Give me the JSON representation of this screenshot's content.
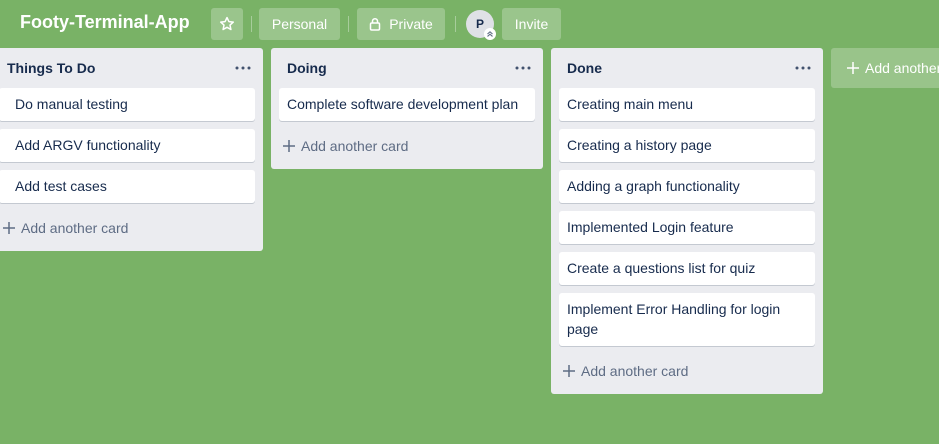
{
  "board": {
    "title": "Footy-Terminal-App",
    "star_icon": "star-icon",
    "visibility_team": "Personal",
    "visibility_privacy": "Private",
    "privacy_icon": "lock-icon",
    "member_initial": "P",
    "invite_label": "Invite",
    "background_color": "#79b266"
  },
  "lists": [
    {
      "title": "Things To Do",
      "menu_icon": "more-horizontal-icon",
      "cards": [
        "Do manual testing",
        "Add ARGV functionality",
        "Add test cases"
      ],
      "add_card_label": "Add another card"
    },
    {
      "title": "Doing",
      "menu_icon": "more-horizontal-icon",
      "cards": [
        "Complete software development plan"
      ],
      "add_card_label": "Add another card"
    },
    {
      "title": "Done",
      "menu_icon": "more-horizontal-icon",
      "cards": [
        "Creating main menu",
        "Creating a history page",
        "Adding a graph functionality",
        "Implemented Login feature",
        "Create a questions list for quiz",
        "Implement Error Handling for login page"
      ],
      "add_card_label": "Add another card"
    }
  ],
  "add_list_label": "Add another list"
}
